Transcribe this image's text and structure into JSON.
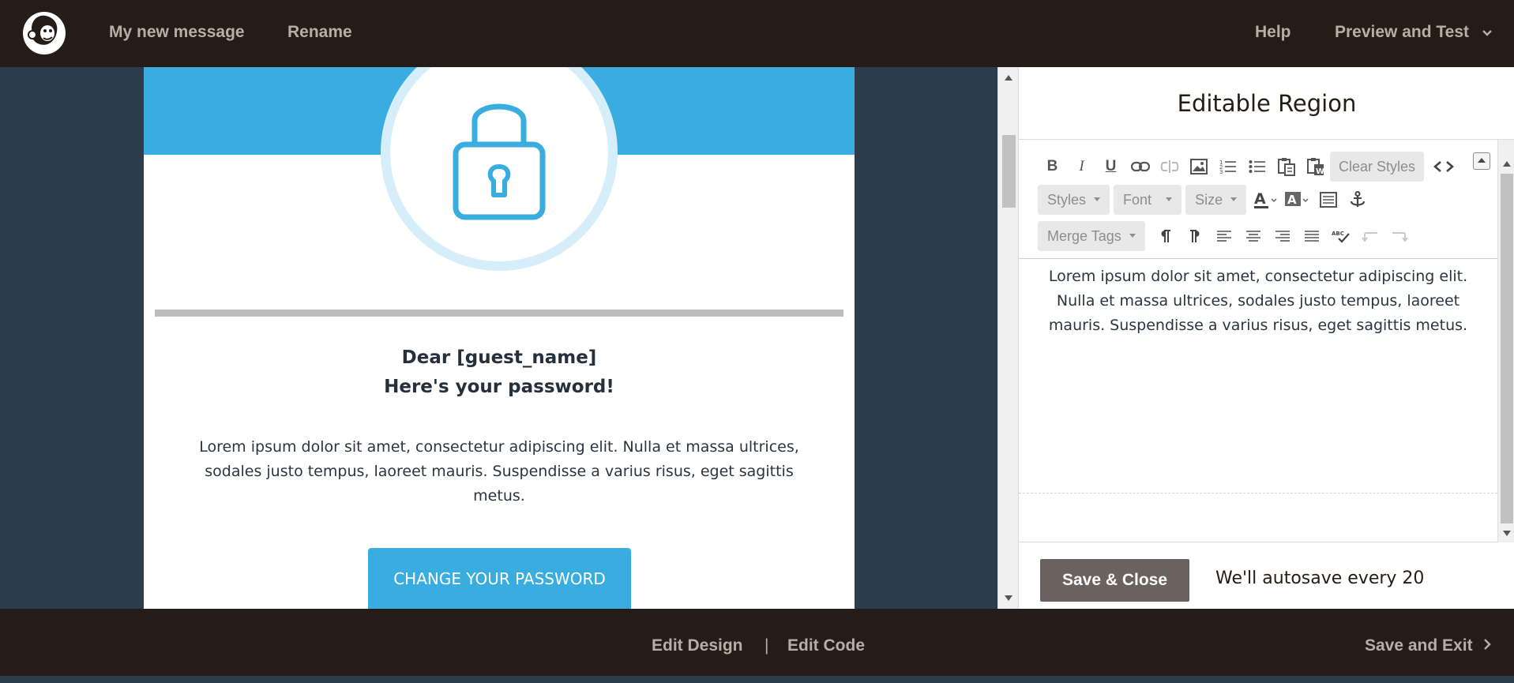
{
  "header": {
    "campaign_name": "My new message",
    "rename_label": "Rename",
    "help_label": "Help",
    "preview_label": "Preview and Test",
    "logo_icon": "mailchimp-freddie-logo-icon"
  },
  "email": {
    "hero_color": "#3aade0",
    "lock_icon": "padlock-icon",
    "heading_line1": "Dear [guest_name]",
    "heading_line2": "Here's your password!",
    "body_text": "Lorem ipsum dolor sit amet, consectetur adipiscing elit. Nulla et massa ultrices, sodales justo tempus, laoreet mauris. Suspendisse a varius risus, eget sagittis metus.",
    "button_label": "CHANGE YOUR PASSWORD"
  },
  "editor": {
    "title": "Editable Region",
    "toolbar": {
      "clear_styles": "Clear Styles",
      "styles_dropdown": "Styles",
      "font_dropdown": "Font",
      "size_dropdown": "Size",
      "merge_tags_dropdown": "Merge Tags",
      "bold_letter": "B",
      "italic_letter": "I",
      "underline_letter": "U"
    },
    "content": "Lorem ipsum dolor sit amet, consectetur adipiscing elit. Nulla et massa ultrices, sodales justo tempus, laoreet mauris. Suspendisse a varius risus, eget sagittis metus.",
    "save_close_label": "Save & Close",
    "autosave_text": "We'll autosave every 20"
  },
  "footer": {
    "edit_design_label": "Edit Design",
    "separator": "|",
    "edit_code_label": "Edit Code",
    "save_exit_label": "Save and Exit"
  },
  "colors": {
    "topbar": "#261c17",
    "canvas_bg": "#2b3c4b",
    "accent_blue": "#3aade0",
    "save_button": "#6b625d"
  }
}
